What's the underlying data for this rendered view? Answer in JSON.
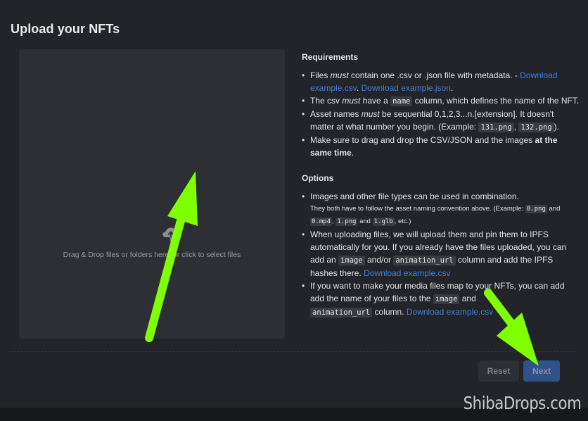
{
  "page": {
    "title": "Upload your NFTs"
  },
  "dropzone": {
    "icon": "cloud-upload-icon",
    "text": "Drag & Drop files or folders here, or click to select files"
  },
  "requirements": {
    "title": "Requirements",
    "items": [
      {
        "t1": "Files ",
        "em": "must",
        "t2": " contain one .csv or .json file with metadata. - ",
        "link1": "Download example.csv",
        "sep": ". ",
        "link2": "Download example.json",
        "end": "."
      },
      {
        "t1": "The csv ",
        "em": "must",
        "t2": " have a ",
        "code": "name",
        "t3": " column, which defines the name of the NFT."
      },
      {
        "t1": "Asset names ",
        "em": "must",
        "t2": " be sequential 0,1,2,3...n.[extension]. It doesn't matter at what number you begin. (Example: ",
        "code1": "131.png",
        "sep": ", ",
        "code2": "132.png",
        "end": ")."
      },
      {
        "t1": "Make sure to drag and drop the CSV/JSON and the images ",
        "strong": "at the same time",
        "end": "."
      }
    ]
  },
  "options": {
    "title": "Options",
    "items": [
      {
        "t1": "Images and other file types can be used in combination.",
        "small1": "They both have to follow the asset naming convention above. (Example: ",
        "code1": "0.png",
        "and1": " and ",
        "code2": "0.mp4",
        "comma": ", ",
        "code3": "1.png",
        "and2": " and ",
        "code4": "1.glb",
        "end": ", etc.)"
      },
      {
        "t1": "When uploading files, we will upload them and pin them to IPFS automatically for you. If you already have the files uploaded, you can add an ",
        "code1": "image",
        "t2": " and/or ",
        "code2": "animation_url",
        "t3": " column and add the IPFS hashes there. ",
        "link": "Download example.csv"
      },
      {
        "t1": "If you want to make your media files map to your NFTs, you can add add the name of your files to the ",
        "code1": "image",
        "t2": " and ",
        "code2": "animation_url",
        "t3": " column. ",
        "link": "Download example.csv"
      }
    ]
  },
  "actions": {
    "reset_label": "Reset",
    "next_label": "Next"
  },
  "watermark": "ShibaDrops.com",
  "colors": {
    "background": "#232429",
    "dropzone": "#2e2f35",
    "link": "#3b7fe0",
    "next_button": "#2e5289",
    "annotation_arrow": "#7fff00"
  }
}
